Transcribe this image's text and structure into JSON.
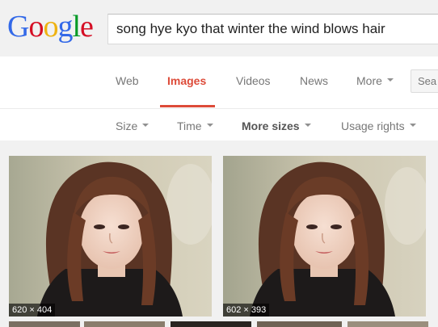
{
  "logo": {
    "letters": [
      {
        "ch": "G",
        "color": "#3369e8"
      },
      {
        "ch": "o",
        "color": "#d50f25"
      },
      {
        "ch": "o",
        "color": "#eeb211"
      },
      {
        "ch": "g",
        "color": "#3369e8"
      },
      {
        "ch": "l",
        "color": "#009925"
      },
      {
        "ch": "e",
        "color": "#d50f25"
      }
    ]
  },
  "search": {
    "query": "song hye kyo that winter the wind blows hair"
  },
  "nav": {
    "tabs": [
      {
        "label": "Web"
      },
      {
        "label": "Images",
        "active": true
      },
      {
        "label": "Videos"
      },
      {
        "label": "News"
      },
      {
        "label": "More"
      }
    ],
    "search_button": "Sea"
  },
  "tools": [
    {
      "label": "Size"
    },
    {
      "label": "Time"
    },
    {
      "label": "More sizes"
    },
    {
      "label": "Usage rights"
    }
  ],
  "results": [
    {
      "dimensions": "620 × 404"
    },
    {
      "dimensions": "602 × 393"
    }
  ],
  "colors": {
    "accent": "#dd4b39",
    "header_bg": "#f1f1f1",
    "results_bg": "#f1f1f1"
  }
}
